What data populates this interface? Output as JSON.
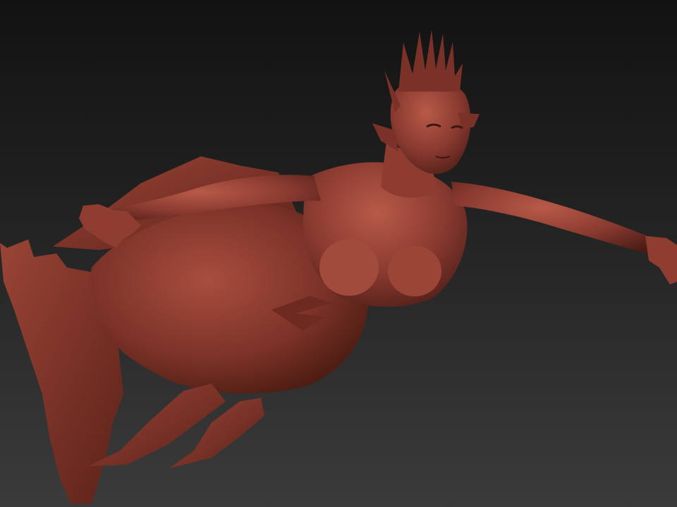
{
  "viewport": {
    "subject": "sculpted-figure",
    "background_top_color": "#121212",
    "background_bottom_color": "#3b3b3b",
    "material_color": "#8a3a30",
    "material_highlight_color": "#b85a48",
    "material_shadow_color": "#4a1c16"
  }
}
